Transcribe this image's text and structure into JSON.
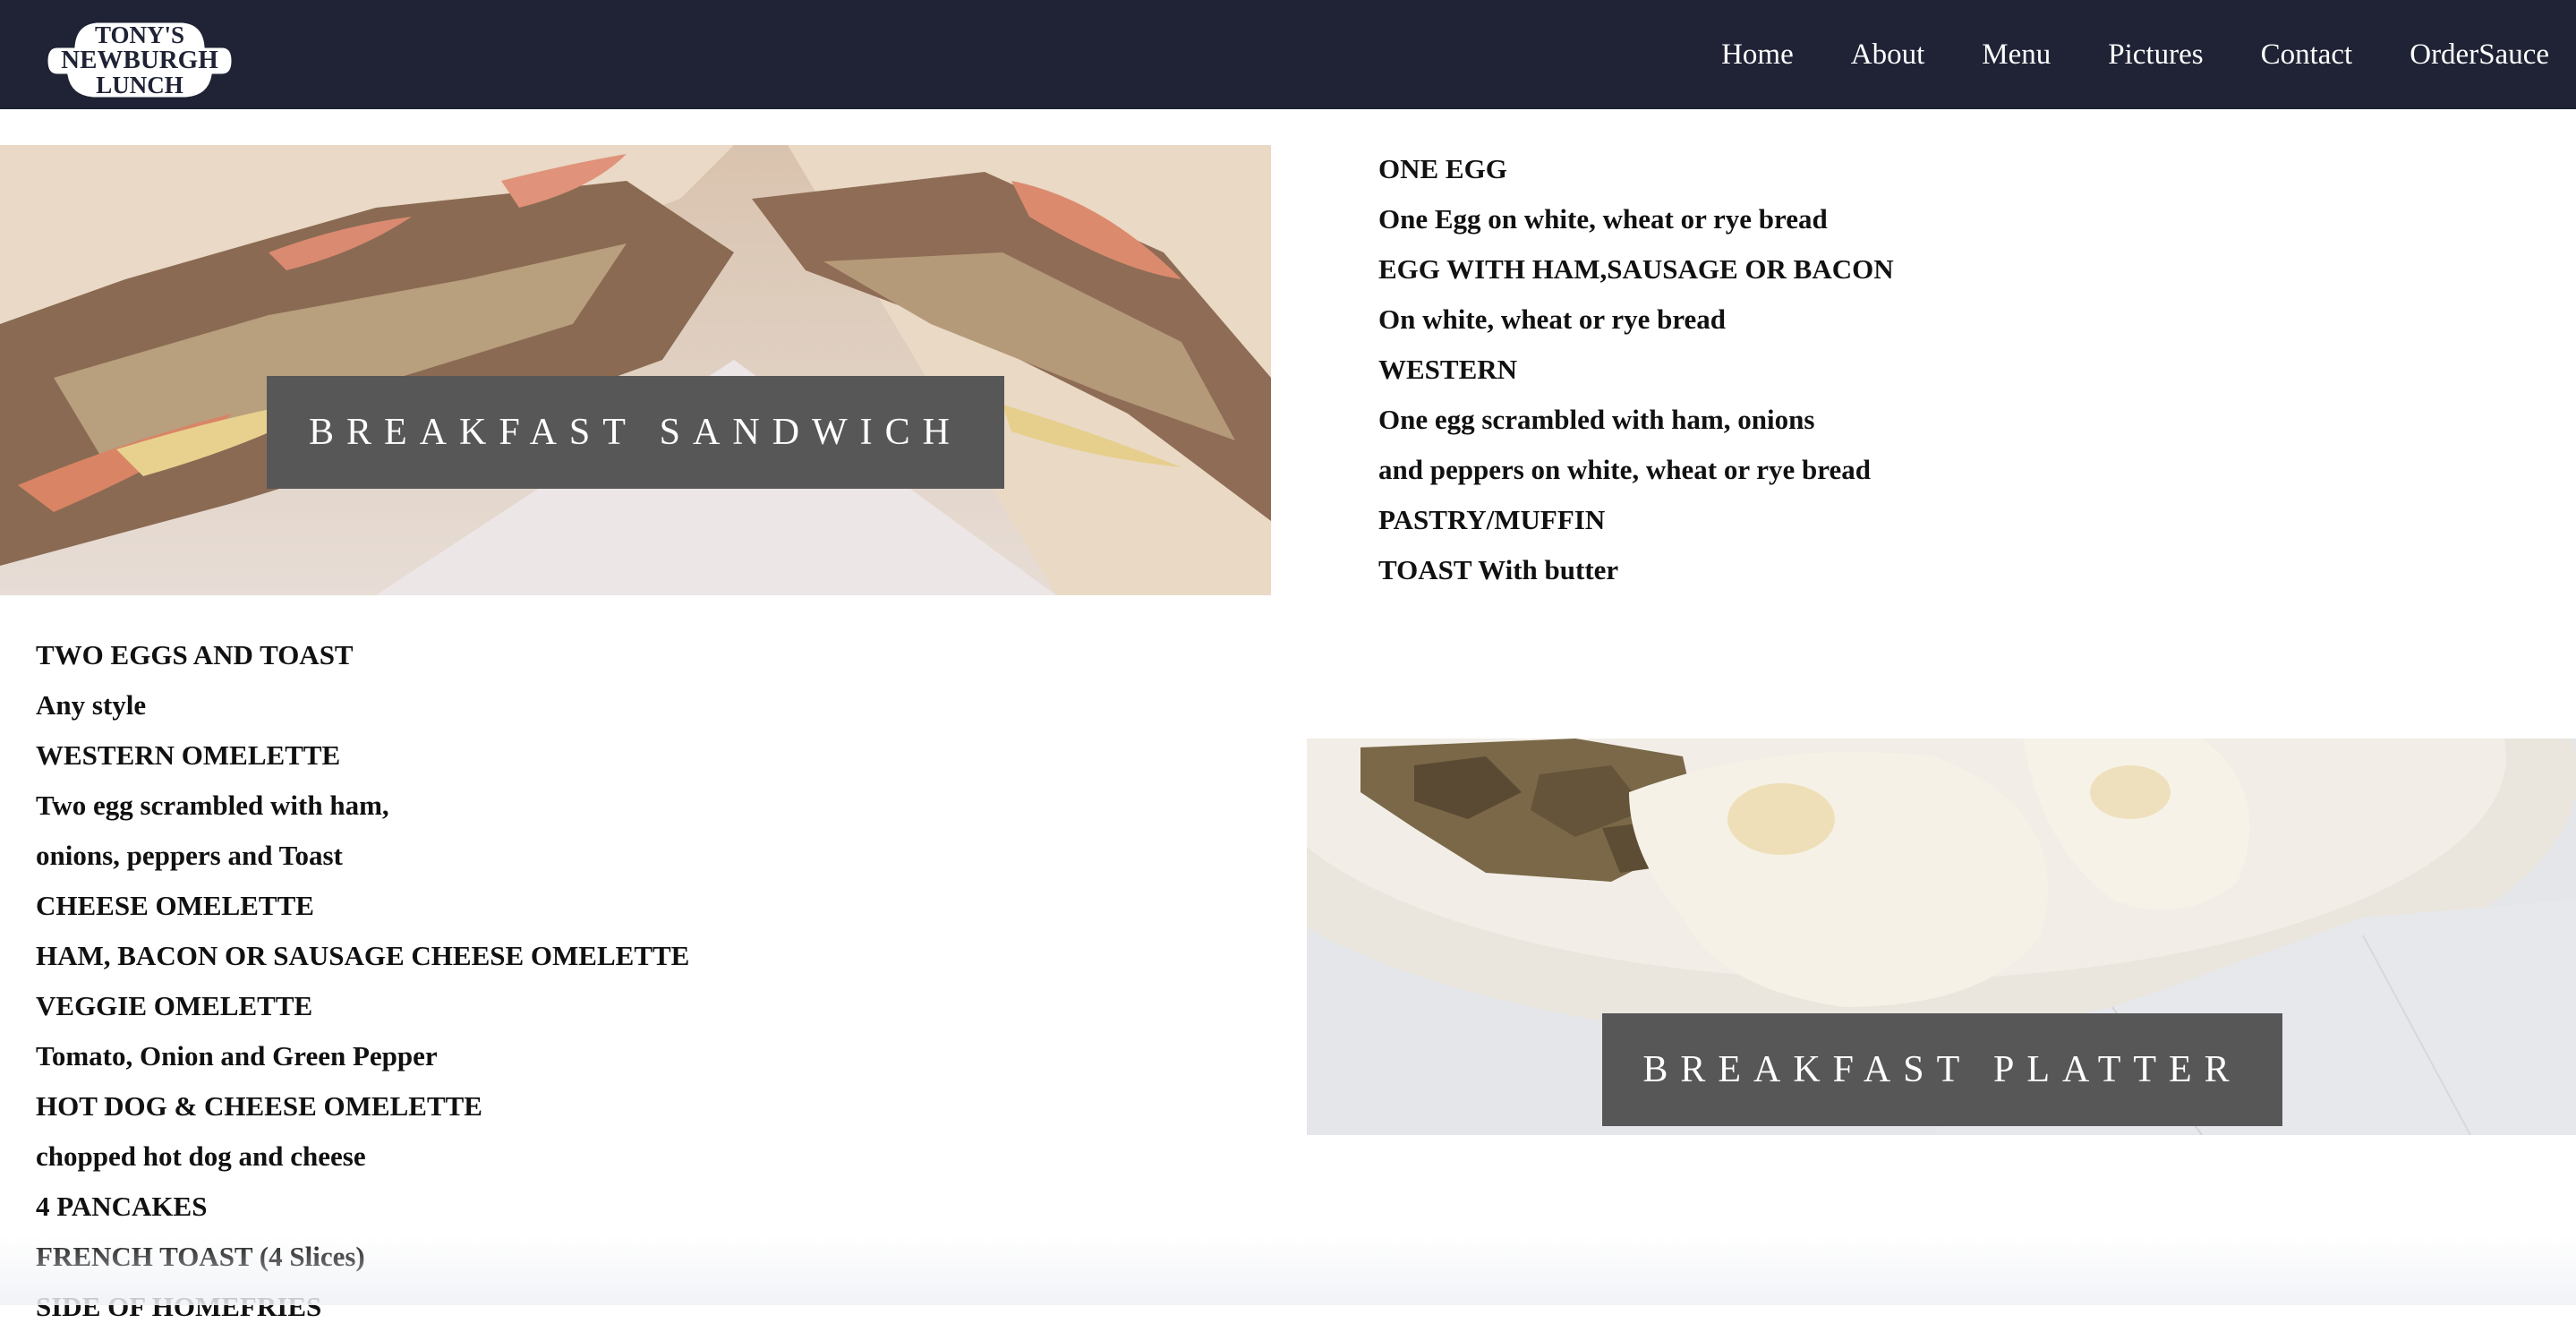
{
  "brand": {
    "logo_line1": "TONY'S",
    "logo_line2": "NEWBURGH",
    "logo_line3": "LUNCH"
  },
  "nav": {
    "items": [
      {
        "label": "Home"
      },
      {
        "label": "About"
      },
      {
        "label": "Menu"
      },
      {
        "label": "Pictures"
      },
      {
        "label": "Contact"
      },
      {
        "label": "OrderSauce"
      }
    ]
  },
  "sections": {
    "sandwich_label": "BREAKFAST SANDWICH",
    "platter_label": "BREAKFAST PLATTER"
  },
  "sandwich_menu": [
    "ONE EGG",
    "One Egg on white, wheat or rye bread",
    "EGG WITH HAM,SAUSAGE OR BACON",
    "On white, wheat or rye bread",
    "WESTERN",
    "One egg scrambled with ham, onions",
    "and peppers on white, wheat or rye bread",
    "PASTRY/MUFFIN",
    "TOAST With butter"
  ],
  "platter_menu": [
    "TWO EGGS AND TOAST",
    "Any style",
    "WESTERN OMELETTE",
    "Two egg scrambled with ham,",
    "onions, peppers and Toast",
    "CHEESE OMELETTE",
    "HAM, BACON OR SAUSAGE CHEESE OMELETTE",
    "VEGGIE OMELETTE",
    "Tomato, Onion and Green Pepper",
    "HOT DOG & CHEESE OMELETTE",
    "chopped hot dog and cheese",
    "4 PANCAKES",
    "FRENCH TOAST (4 Slices)",
    "SIDE OF HOMEFRIES"
  ],
  "colors": {
    "navbar": "#1f2335",
    "label_bg": "#575757",
    "text": "#111111"
  }
}
